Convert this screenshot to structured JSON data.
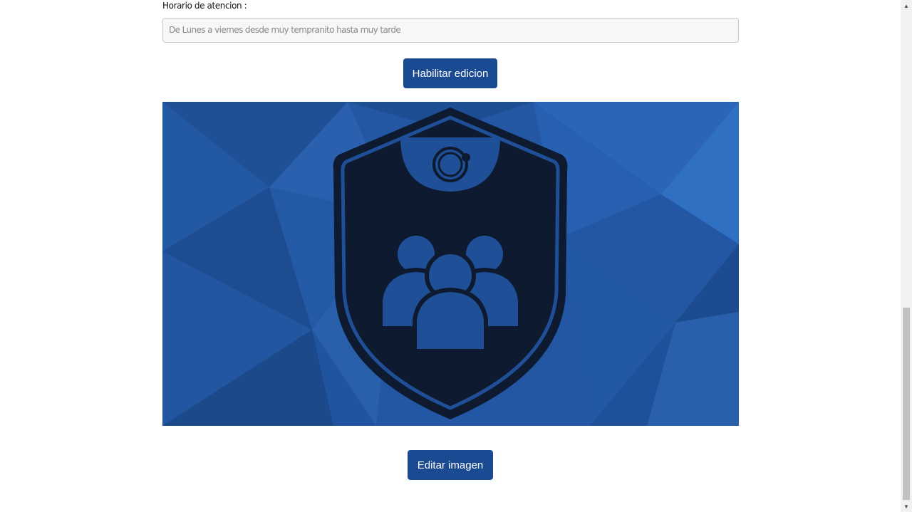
{
  "form": {
    "schedule_label": "Horario de atencion :",
    "schedule_value": "De Lunes a viernes desde muy tempranito hasta muy tarde",
    "enable_edit_label": "Habilitar edicion",
    "edit_image_label": "Editar imagen"
  },
  "image": {
    "alt": "logo",
    "background_color": "#2357a3",
    "shield_color": "#0d1a2f",
    "emblem_color": "#1e4f97",
    "icons": [
      "shield-icon",
      "group-users-icon"
    ]
  },
  "colors": {
    "button": "#1a4a91",
    "input_border": "#c9c9c9"
  },
  "scrollbar": {
    "up_glyph": "▲",
    "down_glyph": "▼"
  }
}
